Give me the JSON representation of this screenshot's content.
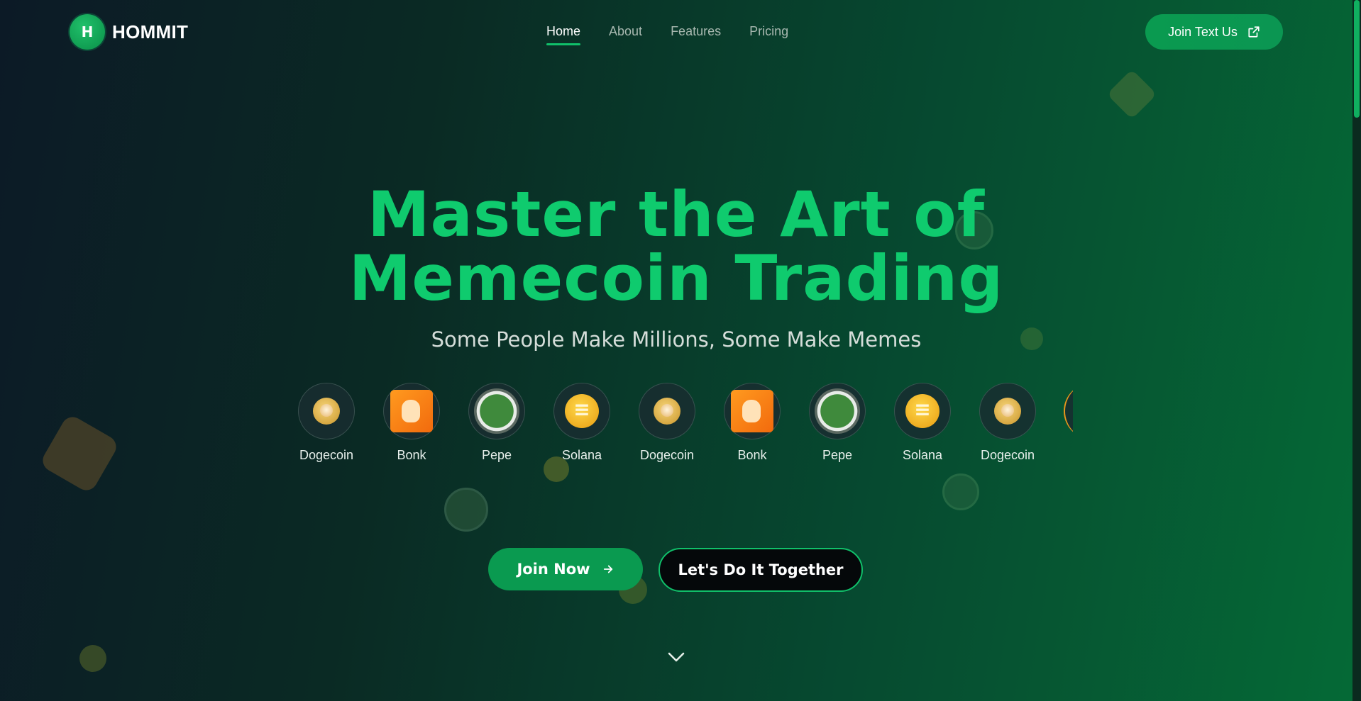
{
  "brand": {
    "logo_letter": "H",
    "name": "HOMMIT"
  },
  "nav": {
    "items": [
      {
        "label": "Home",
        "active": true
      },
      {
        "label": "About",
        "active": false
      },
      {
        "label": "Features",
        "active": false
      },
      {
        "label": "Pricing",
        "active": false
      }
    ]
  },
  "header": {
    "cta_label": "Join Text Us",
    "cta_icon": "external-link-icon"
  },
  "hero": {
    "title_line1": "Master the Art of",
    "title_line2": "Memecoin Trading",
    "subtitle": "Some People Make Millions, Some Make Memes"
  },
  "coins": [
    {
      "label": "Dogecoin",
      "icon": "dogecoin-icon"
    },
    {
      "label": "Bonk",
      "icon": "bonk-icon"
    },
    {
      "label": "Pepe",
      "icon": "pepe-icon"
    },
    {
      "label": "Solana",
      "icon": "solana-icon"
    },
    {
      "label": "Dogecoin",
      "icon": "dogecoin-icon"
    },
    {
      "label": "Bonk",
      "icon": "bonk-icon"
    },
    {
      "label": "Pepe",
      "icon": "pepe-icon"
    },
    {
      "label": "Solana",
      "icon": "solana-icon"
    },
    {
      "label": "Dogecoin",
      "icon": "dogecoin-icon"
    }
  ],
  "cta": {
    "primary_label": "Join Now",
    "primary_icon": "arrow-right-icon",
    "secondary_label": "Let's Do It Together"
  },
  "scroll_icon": "chevron-down-icon",
  "colors": {
    "accent": "#10c06a",
    "title_green": "#0fcb6e",
    "button_green": "#0a9a50",
    "background_start": "#0c1a26",
    "background_end": "#056a36"
  }
}
